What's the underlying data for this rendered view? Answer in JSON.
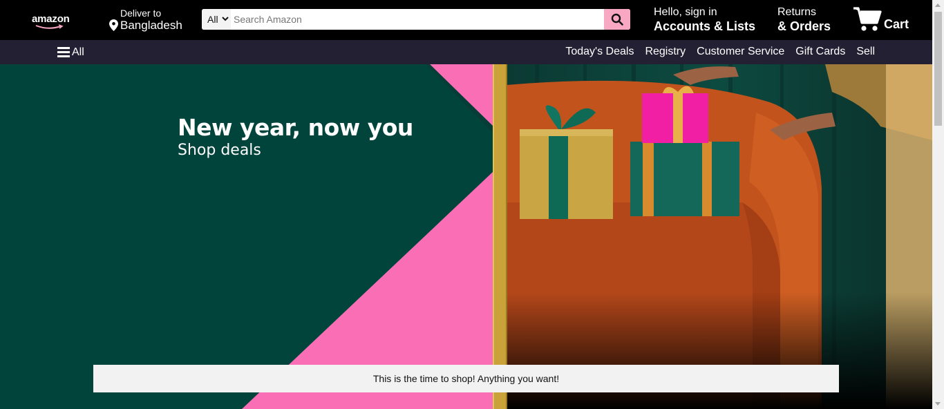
{
  "header": {
    "logo_text": "amazon",
    "deliver_label": "Deliver to",
    "deliver_location": "Bangladesh",
    "search": {
      "category": "All",
      "placeholder": "Search Amazon",
      "value": ""
    },
    "account_line1": "Hello, sign in",
    "account_line2": "Accounts & Lists",
    "returns_line1": "Returns",
    "returns_line2": "& Orders",
    "cart_label": "Cart"
  },
  "nav": {
    "all_label": "All",
    "links": [
      "Today's Deals",
      "Registry",
      "Customer Service",
      "Gift Cards",
      "Sell"
    ]
  },
  "hero": {
    "headline": "New year, now you",
    "subline": "Shop deals"
  },
  "notice": {
    "text": "This is the time to shop! Anything you want!"
  },
  "colors": {
    "topbar": "#000000",
    "navbar": "#232034",
    "hero_green": "#00443c",
    "hero_pink": "#f96eb4",
    "gold": "#c9a23a",
    "search_button": "#f9a8c3"
  },
  "icons": [
    "location-pin-icon",
    "chevron-down-icon",
    "search-icon",
    "cart-icon",
    "hamburger-menu-icon"
  ]
}
